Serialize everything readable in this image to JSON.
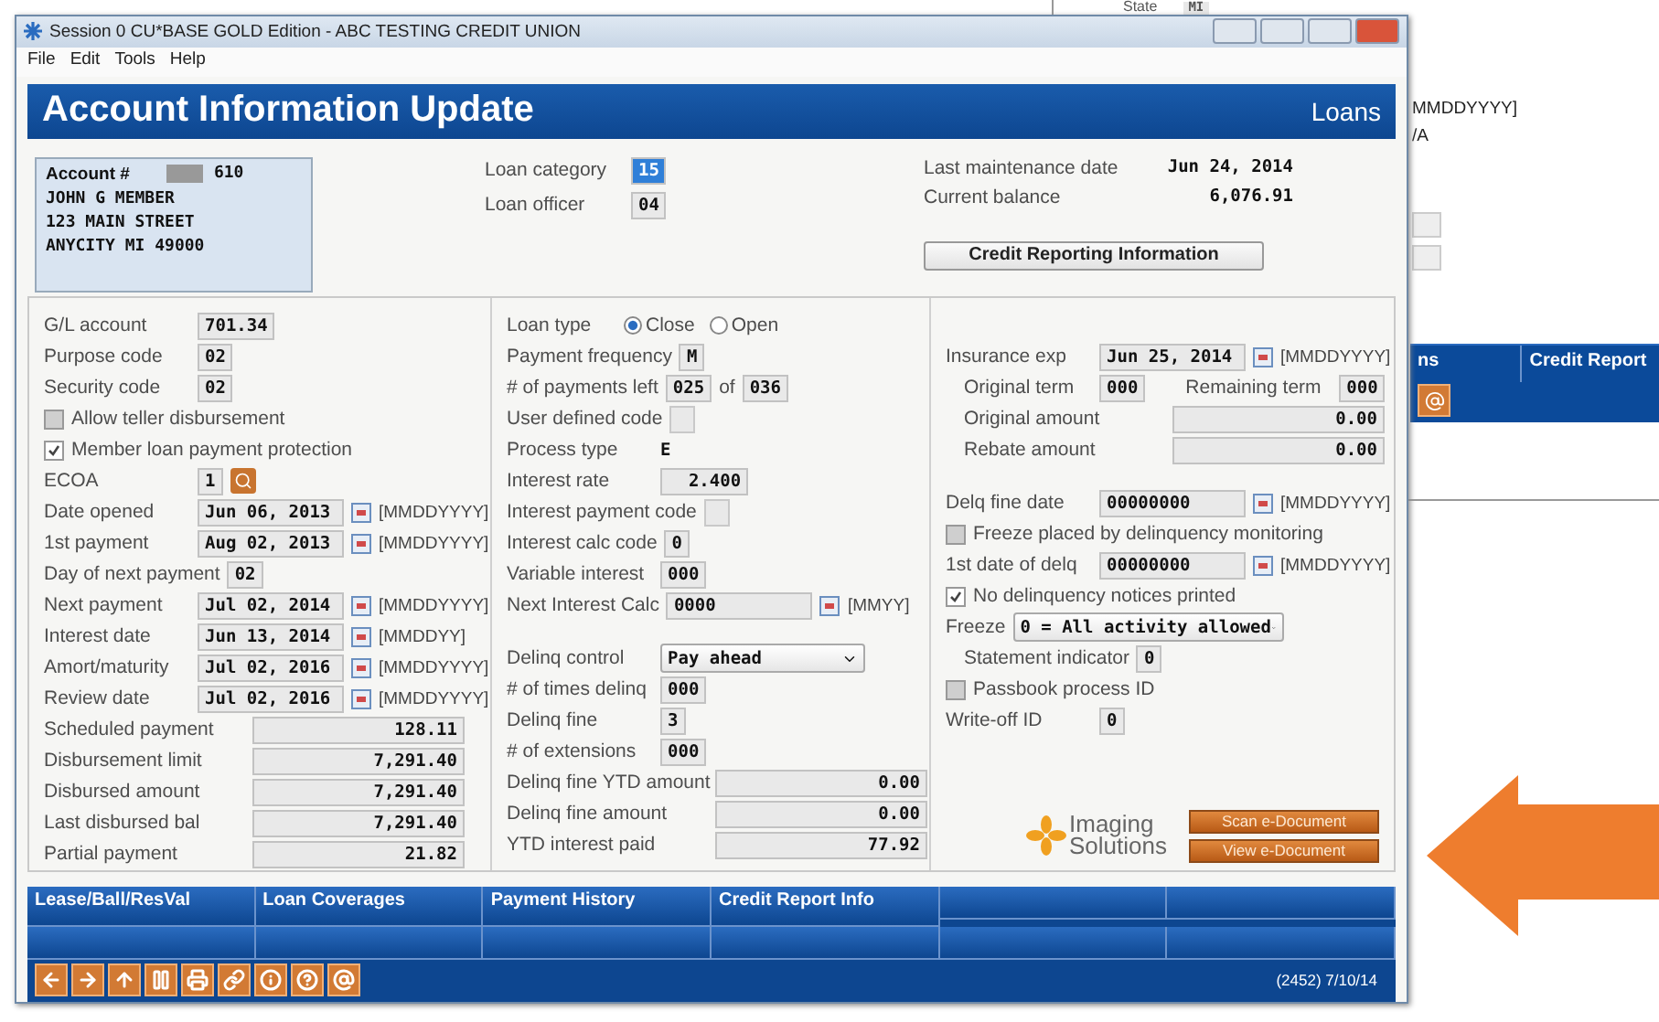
{
  "background_window": {
    "state_label": "State",
    "state_value": "MI",
    "hint": "MMDDYYYY]",
    "value": "/A",
    "tabs": [
      "ns",
      "Credit Report"
    ]
  },
  "window": {
    "title": "Session 0 CU*BASE GOLD Edition - ABC TESTING CREDIT UNION"
  },
  "menu": [
    "File",
    "Edit",
    "Tools",
    "Help"
  ],
  "header": {
    "title": "Account Information Update",
    "section": "Loans"
  },
  "member": {
    "account_label": "Account #",
    "account_suffix": "610",
    "lines": [
      "JOHN G MEMBER",
      "123 MAIN STREET",
      "ANYCITY MI 49000"
    ]
  },
  "loan_info": [
    {
      "label": "Loan category",
      "value": "15",
      "selected": true
    },
    {
      "label": "Loan officer",
      "value": "04",
      "selected": false
    }
  ],
  "maintenance": [
    {
      "label": "Last maintenance date",
      "value": "Jun 24, 2014"
    },
    {
      "label": "Current balance",
      "value": "6,076.91"
    }
  ],
  "credit_button": "Credit Reporting Information",
  "columns": [
    {
      "groups": [
        [
          {
            "kind": "field",
            "label": "G/L account",
            "value": "701.34"
          },
          {
            "kind": "field",
            "label": "Purpose code",
            "value": "02"
          },
          {
            "kind": "field",
            "label": "Security code",
            "value": "02"
          },
          {
            "kind": "checkbox",
            "label": "Allow teller disbursement",
            "checked": false
          },
          {
            "kind": "checkbox",
            "label": "Member loan payment protection",
            "checked": true
          },
          {
            "kind": "lookup",
            "label": "ECOA",
            "value": "1"
          },
          {
            "kind": "date",
            "label": "Date opened",
            "value": "Jun 06, 2013",
            "hint": "[MMDDYYYY]"
          },
          {
            "kind": "date",
            "label": "1st payment",
            "value": "Aug 02, 2013",
            "hint": "[MMDDYYYY]"
          },
          {
            "kind": "field",
            "label": "Day of next payment",
            "value": "02"
          },
          {
            "kind": "date",
            "label": "Next payment",
            "value": "Jul 02, 2014",
            "hint": "[MMDDYYYY]"
          },
          {
            "kind": "date",
            "label": "Interest date",
            "value": "Jun 13, 2014",
            "hint": "[MMDDYY]"
          },
          {
            "kind": "date",
            "label": "Amort/maturity",
            "value": "Jul 02, 2016",
            "hint": "[MMDDYYYY]"
          },
          {
            "kind": "date",
            "label": "Review date",
            "value": "Jul 02, 2016",
            "hint": "[MMDDYYYY]"
          },
          {
            "kind": "amount",
            "label": "Scheduled payment",
            "value": "128.11"
          },
          {
            "kind": "amount",
            "label": "Disbursement limit",
            "value": "7,291.40"
          },
          {
            "kind": "amount",
            "label": "Disbursed amount",
            "value": "7,291.40"
          },
          {
            "kind": "amount",
            "label": "Last disbursed bal",
            "value": "7,291.40"
          },
          {
            "kind": "amount",
            "label": "Partial payment",
            "value": "21.82"
          }
        ]
      ]
    },
    {
      "groups": [
        [
          {
            "kind": "radio",
            "label": "Loan type",
            "options": [
              {
                "label": "Close",
                "selected": true
              },
              {
                "label": "Open",
                "selected": false
              }
            ]
          },
          {
            "kind": "field",
            "label": "Payment frequency",
            "value": "M"
          },
          {
            "kind": "pair",
            "label": "# of payments left",
            "value": "025",
            "joiner": "of",
            "value2": "036"
          },
          {
            "kind": "blank",
            "label": "User defined code"
          },
          {
            "kind": "plain",
            "label": "Process type",
            "value": "E"
          },
          {
            "kind": "field",
            "label": "Interest rate",
            "value": "  2.400"
          },
          {
            "kind": "blank",
            "label": "Interest payment code"
          },
          {
            "kind": "field",
            "label": "Interest calc code",
            "value": "0"
          },
          {
            "kind": "field",
            "label": "Variable interest",
            "value": "000"
          },
          {
            "kind": "date",
            "label": "Next Interest Calc",
            "value": "0000",
            "hint": "[MMYY]"
          }
        ],
        [
          {
            "kind": "select",
            "label": "Delinq control",
            "value": "Pay ahead"
          },
          {
            "kind": "field",
            "label": "# of times delinq",
            "value": "000"
          },
          {
            "kind": "field",
            "label": "Delinq fine",
            "value": "3"
          },
          {
            "kind": "field",
            "label": "# of extensions",
            "value": "000"
          },
          {
            "kind": "amount",
            "label": "Delinq fine YTD amount",
            "value": "0.00"
          },
          {
            "kind": "amount",
            "label": "Delinq fine amount",
            "value": "0.00"
          },
          {
            "kind": "amount",
            "label": "YTD interest paid",
            "value": "77.92"
          }
        ]
      ]
    },
    {
      "groups": [
        [
          {
            "kind": "date",
            "label": "Insurance exp",
            "value": "Jun 25, 2014",
            "hint": "[MMDDYYYY]"
          },
          {
            "kind": "double",
            "label": "Original term",
            "value": "000",
            "label2": "Remaining term",
            "value2": "000"
          },
          {
            "kind": "amount",
            "label": "Original amount",
            "value": "0.00",
            "indent": true
          },
          {
            "kind": "amount",
            "label": "Rebate amount",
            "value": "0.00",
            "indent": true
          }
        ],
        [
          {
            "kind": "date",
            "label": "Delq fine date",
            "value": "00000000",
            "hint": "[MMDDYYYY]"
          },
          {
            "kind": "checkbox",
            "label": "Freeze placed by delinquency monitoring",
            "checked": false
          },
          {
            "kind": "date",
            "label": "1st date of delq",
            "value": "00000000",
            "hint": "[MMDDYYYY]"
          },
          {
            "kind": "checkbox",
            "label": "No delinquency notices printed",
            "checked": true
          },
          {
            "kind": "select",
            "label": "Freeze",
            "value": "0 = All activity allowed"
          },
          {
            "kind": "field",
            "label": "Statement indicator",
            "value": "0",
            "indent": true
          },
          {
            "kind": "checkbox",
            "label": "Passbook process ID",
            "checked": false
          },
          {
            "kind": "field",
            "label": "Write-off ID",
            "value": "0"
          }
        ]
      ]
    }
  ],
  "logo": {
    "line1": "Imaging",
    "line2": "Solutions"
  },
  "document_buttons": [
    "Scan e-Document",
    "View e-Document"
  ],
  "bottom_tabs": [
    "Lease/Ball/ResVal",
    "Loan Coverages",
    "Payment History",
    "Credit Report Info"
  ],
  "status": "(2452) 7/10/14"
}
